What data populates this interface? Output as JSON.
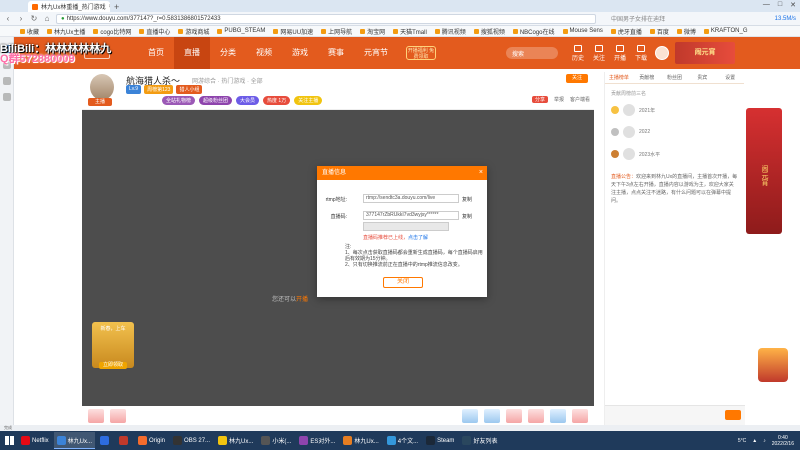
{
  "overlay": {
    "bilibili": "BiliBili：林林林林林九",
    "qq_group": "Q群572880009"
  },
  "browser": {
    "tab_title": "林九Ux林重播_热门游戏",
    "url": "https://www.douyu.com/377147?_r=0.5831386801572433",
    "search_hint": "中国男子女排在迪拜",
    "counter": "13.5M/s",
    "window_controls": [
      "—",
      "□",
      "✕"
    ]
  },
  "bookmarks": [
    "收藏",
    "林九Ux主播",
    "cogo比特网",
    "直播中心",
    "游戏商城",
    "PUBG_STEAM",
    "网易UU加速",
    "上网导航",
    "淘宝网",
    "天猫Tmall",
    "腾讯视频",
    "搜狐视频",
    "NBCogo在线",
    "Mouse Sens",
    "虎牙直播",
    "百度",
    "微博",
    "KRAFTON_G"
  ],
  "site": {
    "logo": "斗鱼",
    "nav": [
      "首页",
      "直播",
      "分类",
      "视频",
      "游戏",
      "赛事",
      "元宵节"
    ],
    "nav_badge": "开播福利 免费领取",
    "search_placeholder": "搜索",
    "header_icons": [
      "历史",
      "关注",
      "开播",
      "下载"
    ],
    "banner_text": "闹元宵"
  },
  "room": {
    "title": "航海猎人杀～",
    "category": "网游综合 · 热门游戏 · 全部",
    "anchor_tag": "主播",
    "follow": "关注",
    "badges": [
      "Lv.9",
      "周榜第123",
      "猎人小组"
    ],
    "badges2": [
      "全站礼物榜",
      "超级粉丝团",
      "大会员",
      "热度 1万",
      "关注主播"
    ],
    "tools": [
      "分享",
      "举报",
      "客户端看"
    ]
  },
  "player": {
    "message": "您还可以",
    "message_link": "开播"
  },
  "side_promo": {
    "title": "新春，上车",
    "button": "立即领取"
  },
  "chat": {
    "tabs": [
      "主播榜单",
      "贡献榜",
      "粉丝团",
      "贵宾",
      "设置"
    ],
    "rank_header": "贡献周榜前三名",
    "ranks": [
      "2021年",
      "2022",
      "2023水平"
    ],
    "notice_label": "直播公告：",
    "notice": "欢迎来到林九Ux的直播间，主播首次开播，每天下午3点左右开播，直播内容以游戏为主，欢迎大家关注主播，点点关注不迷路，有什么问题可以在弹幕中提问。"
  },
  "modal": {
    "title": "直播信息",
    "close": "×",
    "rtmp_label": "rtmp地址:",
    "rtmp_value": "rtmp://sendtc3a.douyu.com/live",
    "key_label": "直播码:",
    "key_value": "377147rZbRUkkI7vd3wyjsy******",
    "copy": "复制",
    "warning": "直播码推荐已上线，",
    "warning_link": "点击了解",
    "note_title": "注:",
    "note_1": "1、每次点击获取直播码都会重新生成直播码，每个直播码启用后有效期为15分钟。",
    "note_2": "2、只有切换推流前正在直播中的rtmp推流信息改变。",
    "button": "关闭"
  },
  "status_bar": "完成",
  "taskbar": {
    "tasks": [
      "Netflix",
      "林九Ux...",
      "",
      "",
      "Origin",
      "OBS 27...",
      "林九Ux...",
      "小米(...",
      "ES对外...",
      "林九Ux...",
      "4个文...",
      "Steam",
      "好友列表"
    ],
    "weather": "5°C",
    "time": "0:40",
    "date": "2022/2/16"
  }
}
